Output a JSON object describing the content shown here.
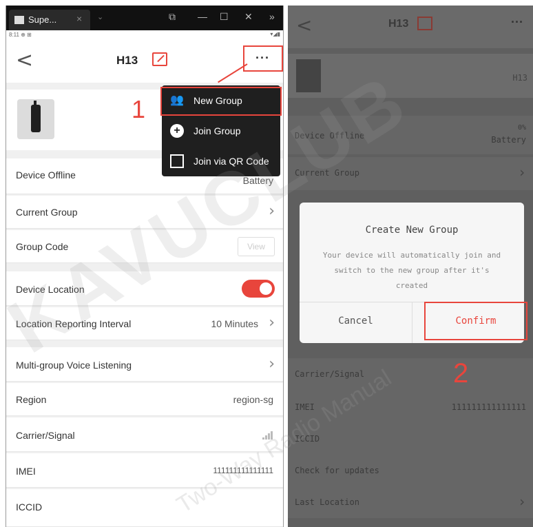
{
  "left": {
    "window_tab_title": "Supe...",
    "window_controls": [
      "⧉",
      "—",
      "☐",
      "✕",
      "»"
    ],
    "status_time": "8:11 ⊕ ⊞",
    "status_icons": "▾◢▮",
    "title": "H13",
    "more_label": "···",
    "step1": "1",
    "menu": [
      {
        "label": "New Group",
        "icon": "group-icon"
      },
      {
        "label": "Join Group",
        "icon": "plus-circle-icon"
      },
      {
        "label": "Join via QR Code",
        "icon": "qr-code-icon"
      }
    ],
    "rows": {
      "device_status": "Device Offline",
      "battery_top": "0%",
      "battery": "Battery",
      "current_group": "Current Group",
      "group_code": "Group Code",
      "view": "View",
      "device_location": "Device Location",
      "location_interval": "Location Reporting Interval",
      "interval_value": "10 Minutes",
      "multi_group": "Multi-group Voice Listening",
      "region": "Region",
      "region_value": "region-sg",
      "carrier": "Carrier/Signal",
      "imei": "IMEI",
      "imei_value": "111111111111111",
      "iccid": "ICCID"
    },
    "device_location_on": true
  },
  "right": {
    "title": "H13",
    "more_label": "···",
    "device_name": "H13",
    "rows": {
      "device_status": "Device Offline",
      "battery_top": "0%",
      "battery": "Battery",
      "current_group": "Current Group",
      "carrier": "Carrier/Signal",
      "imei": "IMEI",
      "imei_value": "111111111111111",
      "iccid": "ICCID",
      "updates": "Check for updates",
      "last_location": "Last Location"
    },
    "dialog": {
      "title": "Create New Group",
      "message": "Your device will automatically join and switch to the new group after it's created",
      "cancel": "Cancel",
      "confirm": "Confirm"
    },
    "step2": "2"
  },
  "watermark": "KAVUCLUB",
  "watermark_sub": "Two-Way Radio Manual",
  "colors": {
    "accent": "#e8453c",
    "menu_bg": "#1f1f1f",
    "overlay": "#5f5f5f"
  }
}
